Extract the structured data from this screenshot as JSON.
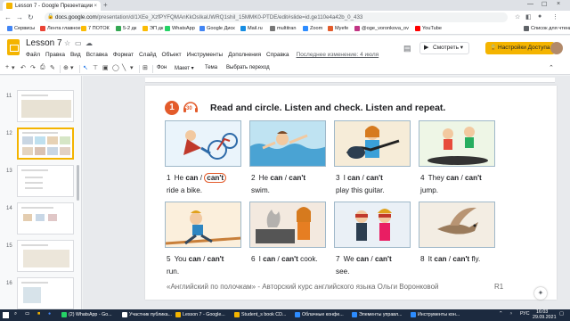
{
  "browser": {
    "tab_title": "Lesson 7 - Google Презентации",
    "tab_close": "×",
    "new_tab": "+",
    "url_host": "docs.google.com",
    "url_path": "/presentation/d/1XEe_XzfPYFQMAnKkOsIkaUWRQ1shiI_15MMK0-PTDE/edit#slide=id.ge110e4a42b_0_433",
    "window_controls": [
      "—",
      "☐",
      "×"
    ]
  },
  "bookmarks": [
    {
      "label": "Сервисы",
      "color": "#4285f4"
    },
    {
      "label": "Лента главное",
      "color": "#ea4335"
    },
    {
      "label": "7 ПОТОК",
      "color": "#fbbc05"
    },
    {
      "label": "5-2 дк",
      "color": "#34a853"
    },
    {
      "label": "ЭП дк",
      "color": "#fbbc05"
    },
    {
      "label": "WhatsApp",
      "color": "#25d366"
    },
    {
      "label": "Google Диск",
      "color": "#4285f4"
    },
    {
      "label": "Mail.ru",
      "color": "#168de2"
    },
    {
      "label": "multitran",
      "color": "#777777"
    },
    {
      "label": "Zoom",
      "color": "#2d8cff"
    },
    {
      "label": "Myefe",
      "color": "#e35b2b"
    },
    {
      "label": "@oge_voronkova_ov",
      "color": "#c13584"
    },
    {
      "label": "YouTube",
      "color": "#ff0000"
    },
    {
      "label": "Список для чтения",
      "color": "#5f6368"
    }
  ],
  "slides_header": {
    "doc_title": "Lesson 7",
    "menu": [
      "Файл",
      "Правка",
      "Вид",
      "Вставка",
      "Формат",
      "Слайд",
      "Объект",
      "Инструменты",
      "Дополнения",
      "Справка"
    ],
    "last_edit": "Последнее изменение: 4 июля",
    "present_label": "Смотреть",
    "share_label": "Настройки Доступа"
  },
  "toolbar": {
    "background_label": "Фон",
    "layout_label": "Макет",
    "theme_label": "Тема",
    "transition_label": "Выбрать переход"
  },
  "filmstrip": {
    "slide_numbers": [
      "11",
      "12",
      "13",
      "14",
      "15",
      "16"
    ],
    "selected": "12"
  },
  "slide": {
    "exercise_number": "1",
    "track_number": "30",
    "instruction": "Read and circle. Listen and check. Listen and repeat.",
    "items": [
      {
        "n": "1",
        "pre": "He",
        "can": "can",
        "slash": "/",
        "cant": "can't",
        "post": "ride a bike.",
        "circled": "cant"
      },
      {
        "n": "2",
        "pre": "He",
        "can": "can",
        "slash": "/",
        "cant": "can't",
        "post": "swim.",
        "circled": ""
      },
      {
        "n": "3",
        "pre": "I",
        "can": "can",
        "slash": "/",
        "cant": "can't",
        "post": "play this guitar.",
        "circled": ""
      },
      {
        "n": "4",
        "pre": "They",
        "can": "can",
        "slash": "/",
        "cant": "can't",
        "post": "jump.",
        "circled": ""
      },
      {
        "n": "5",
        "pre": "You",
        "can": "can",
        "slash": "/",
        "cant": "can't",
        "post": "run.",
        "circled": ""
      },
      {
        "n": "6",
        "pre": "I",
        "can": "can",
        "slash": "/",
        "cant": "can't",
        "post": "cook.",
        "circled": ""
      },
      {
        "n": "7",
        "pre": "We",
        "can": "can",
        "slash": "/",
        "cant": "can't",
        "post": "see.",
        "circled": ""
      },
      {
        "n": "8",
        "pre": "It",
        "can": "can",
        "slash": "/",
        "cant": "can't",
        "post": "fly.",
        "circled": ""
      }
    ],
    "footer": "«Английский по полочкам» - Авторский курс английского языка Ольги Воронковой",
    "page_label": "R1"
  },
  "taskbar": {
    "items": [
      {
        "label": "(2) WhatsApp - Go...",
        "color": "#25d366"
      },
      {
        "label": "Участник публика...",
        "color": "#ffffff"
      },
      {
        "label": "Lesson 7 - Google...",
        "color": "#f4b400"
      },
      {
        "label": "Student_s book CD...",
        "color": "#f4b400"
      },
      {
        "label": "Облачные конфе...",
        "color": "#2d8cff"
      },
      {
        "label": "Элементы управл...",
        "color": "#2d8cff"
      },
      {
        "label": "Инструменты кон...",
        "color": "#2d8cff"
      }
    ],
    "lang": "РУС",
    "time": "16:03",
    "date": "29.09.2021"
  }
}
